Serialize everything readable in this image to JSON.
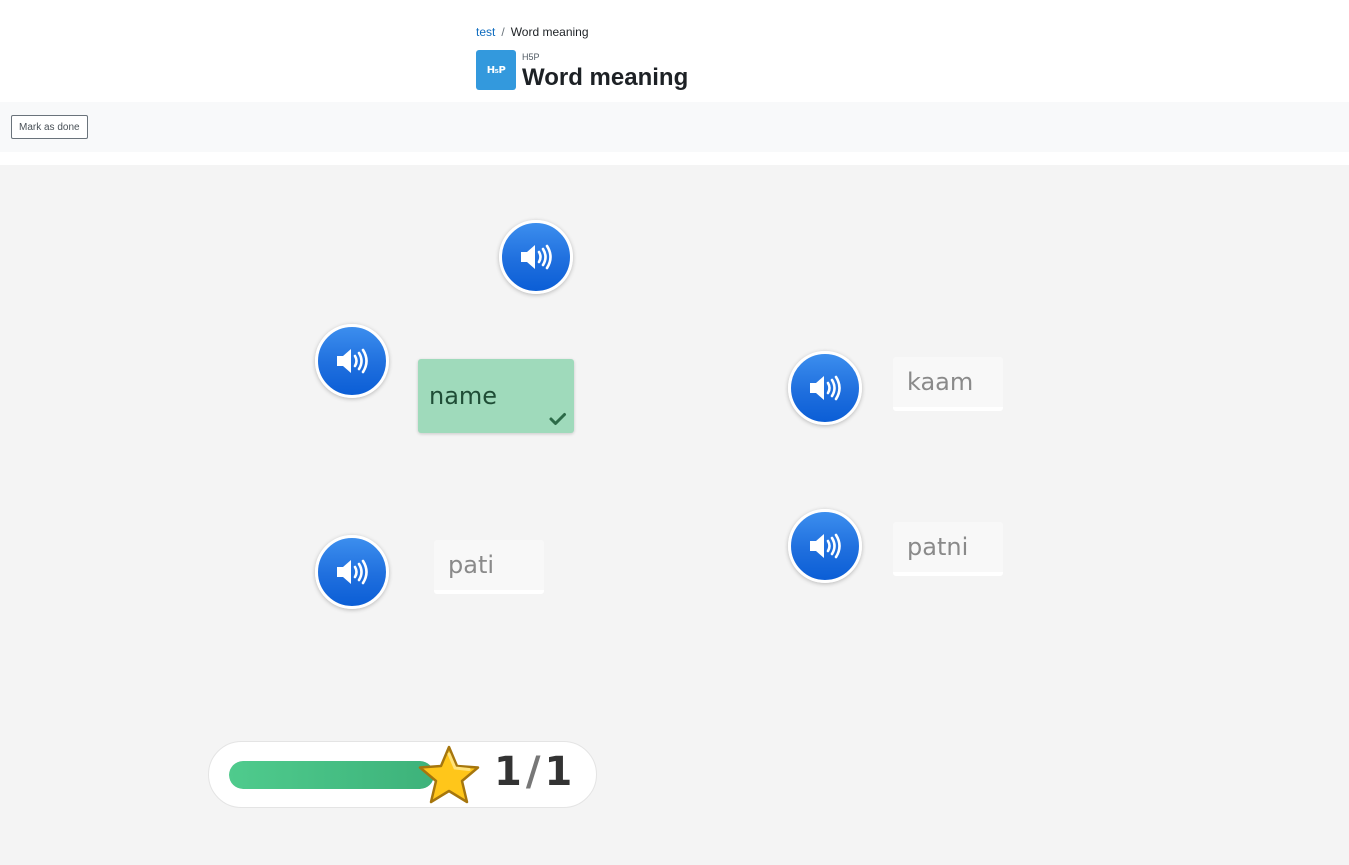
{
  "breadcrumb": {
    "parent": "test",
    "current": "Word meaning"
  },
  "activity": {
    "icon_text": "H₅P",
    "type_label": "H5P",
    "title": "Word meaning"
  },
  "actions": {
    "mark_done_label": "Mark as done"
  },
  "game": {
    "audio_button_icon": "speaker-icon",
    "words": [
      {
        "text": "name",
        "state": "correct"
      },
      {
        "text": "kaam",
        "state": "unplaced"
      },
      {
        "text": "pati",
        "state": "unplaced"
      },
      {
        "text": "patni",
        "state": "unplaced"
      }
    ]
  },
  "progress": {
    "fraction": 1.0,
    "score": "1",
    "total": "1",
    "icon": "star-icon"
  },
  "colors": {
    "accent": "#3399dd",
    "audio_button": "#1f6fde",
    "correct": "#9fdabb",
    "progress": "#4fcb8d",
    "star": "#ffc61a"
  }
}
